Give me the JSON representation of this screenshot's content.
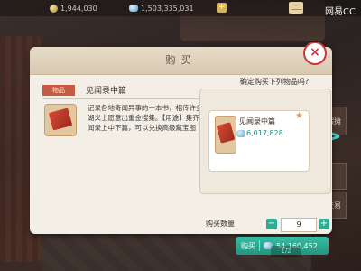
{
  "topbar": {
    "coin_amount": "1,944,030",
    "jade_amount": "1,503,335,031",
    "plus_label": "+",
    "brand": "网易CC"
  },
  "panel": {
    "title": "购买",
    "close_label": "×"
  },
  "item": {
    "tag": "物品",
    "name": "见闻录中篇",
    "description": "记录各地奇闻异事的一本书，相传许多江湖义士愿意出重金搜集。【用途】集齐见闻录上中下篇，可以兑换高级藏宝图"
  },
  "confirm": {
    "question": "确定购买下列物品吗?",
    "card_name": "见闻录中篇",
    "card_price": "6,017,828",
    "quantity_label": "购买数量",
    "quantity_value": "9",
    "minus": "−",
    "plus": "+",
    "buy_label": "购买",
    "buy_total": "54,160,452"
  },
  "side": {
    "tab1": "摆摊",
    "tab3": "交易",
    "arrow": ">"
  },
  "footer": {
    "page": "1/2"
  },
  "colors": {
    "accent_teal": "#2cae93",
    "close_red": "#c9383d",
    "tag_red": "#c65b45"
  },
  "icons": {
    "coin": "coin-icon",
    "jade": "jade-icon",
    "mail": "mail-icon",
    "book": "book-icon",
    "star": "star-icon"
  }
}
